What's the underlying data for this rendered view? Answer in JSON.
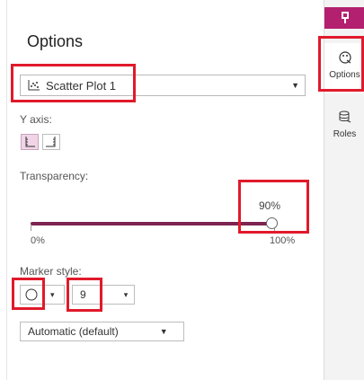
{
  "panel": {
    "title": "Options",
    "object_select": {
      "value": "Scatter Plot 1",
      "icon": "scatter-plot-icon"
    },
    "y_axis": {
      "label": "Y axis:",
      "buttons": [
        {
          "name": "y-axis-left",
          "icon": "axis-left-icon",
          "selected": true
        },
        {
          "name": "y-axis-right",
          "icon": "axis-right-icon",
          "selected": false
        }
      ]
    },
    "transparency": {
      "label": "Transparency:",
      "value_label": "90%",
      "min_label": "0%",
      "max_label": "100%",
      "level": 0.9
    },
    "marker_style": {
      "label": "Marker style:",
      "shape_icon": "circle-marker-icon",
      "size_value": "9",
      "size_caret": "▾",
      "shape_caret": "▾"
    },
    "automatic_select": {
      "value": "Automatic (default)"
    }
  },
  "right_rail": {
    "pin_icon": "pin-icon",
    "items": [
      {
        "label": "Options",
        "icon": "palette-icon",
        "active": true
      },
      {
        "label": "Roles",
        "icon": "database-roles-icon",
        "active": false
      }
    ]
  },
  "colors": {
    "accent": "#b3206f",
    "slider": "#7d2451",
    "highlight_box": "#e01a2b"
  }
}
